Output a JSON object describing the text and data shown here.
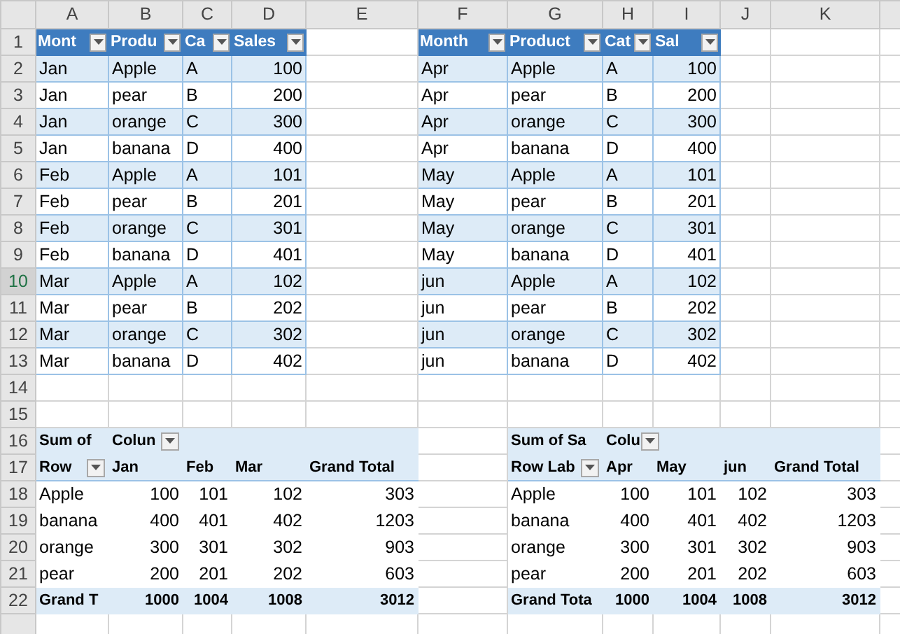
{
  "column_headers": [
    "A",
    "B",
    "C",
    "D",
    "E",
    "F",
    "G",
    "H",
    "I",
    "J",
    "K"
  ],
  "row_headers": [
    {
      "label": "1",
      "selected": false
    },
    {
      "label": "2",
      "selected": false
    },
    {
      "label": "3",
      "selected": false
    },
    {
      "label": "4",
      "selected": false
    },
    {
      "label": "5",
      "selected": false
    },
    {
      "label": "6",
      "selected": false
    },
    {
      "label": "7",
      "selected": false
    },
    {
      "label": "8",
      "selected": false
    },
    {
      "label": "9",
      "selected": false
    },
    {
      "label": "10",
      "selected": true
    },
    {
      "label": "11",
      "selected": false
    },
    {
      "label": "12",
      "selected": false
    },
    {
      "label": "13",
      "selected": false
    },
    {
      "label": "14",
      "selected": false
    },
    {
      "label": "15",
      "selected": false
    },
    {
      "label": "16",
      "selected": false
    },
    {
      "label": "17",
      "selected": false
    },
    {
      "label": "18",
      "selected": false
    },
    {
      "label": "19",
      "selected": false
    },
    {
      "label": "20",
      "selected": false
    },
    {
      "label": "21",
      "selected": false
    },
    {
      "label": "22",
      "selected": false
    }
  ],
  "tables": [
    {
      "columns": [
        "Mont",
        "Produ",
        "Ca",
        "Sales"
      ],
      "rows": [
        [
          "Jan",
          "Apple",
          "A",
          "100"
        ],
        [
          "Jan",
          "pear",
          "B",
          "200"
        ],
        [
          "Jan",
          "orange",
          "C",
          "300"
        ],
        [
          "Jan",
          "banana",
          "D",
          "400"
        ],
        [
          "Feb",
          "Apple",
          "A",
          "101"
        ],
        [
          "Feb",
          "pear",
          "B",
          "201"
        ],
        [
          "Feb",
          "orange",
          "C",
          "301"
        ],
        [
          "Feb",
          "banana",
          "D",
          "401"
        ],
        [
          "Mar",
          "Apple",
          "A",
          "102"
        ],
        [
          "Mar",
          "pear",
          "B",
          "202"
        ],
        [
          "Mar",
          "orange",
          "C",
          "302"
        ],
        [
          "Mar",
          "banana",
          "D",
          "402"
        ]
      ]
    },
    {
      "columns": [
        "Month",
        "Product",
        "Cat",
        "Sal"
      ],
      "rows": [
        [
          "Apr",
          "Apple",
          "A",
          "100"
        ],
        [
          "Apr",
          "pear",
          "B",
          "200"
        ],
        [
          "Apr",
          "orange",
          "C",
          "300"
        ],
        [
          "Apr",
          "banana",
          "D",
          "400"
        ],
        [
          "May",
          "Apple",
          "A",
          "101"
        ],
        [
          "May",
          "pear",
          "B",
          "201"
        ],
        [
          "May",
          "orange",
          "C",
          "301"
        ],
        [
          "May",
          "banana",
          "D",
          "401"
        ],
        [
          "jun",
          "Apple",
          "A",
          "102"
        ],
        [
          "jun",
          "pear",
          "B",
          "202"
        ],
        [
          "jun",
          "orange",
          "C",
          "302"
        ],
        [
          "jun",
          "banana",
          "D",
          "402"
        ]
      ]
    }
  ],
  "pivots": [
    {
      "title": [
        {
          "text": "Sum of",
          "filter": false
        },
        {
          "text": "Colun",
          "filter": true
        }
      ],
      "header": [
        {
          "text": "Row",
          "filter": true
        },
        {
          "text": "Jan",
          "filter": false
        },
        {
          "text": "Feb",
          "filter": false
        },
        {
          "text": "Mar",
          "filter": false
        },
        {
          "text": "Grand Total",
          "filter": false
        }
      ],
      "rows": [
        [
          "Apple",
          "100",
          "101",
          "102",
          "303"
        ],
        [
          "banana",
          "400",
          "401",
          "402",
          "1203"
        ],
        [
          "orange",
          "300",
          "301",
          "302",
          "903"
        ],
        [
          "pear",
          "200",
          "201",
          "202",
          "603"
        ]
      ],
      "total": [
        "Grand T",
        "1000",
        "1004",
        "1008",
        "3012"
      ]
    },
    {
      "title": [
        {
          "text": "Sum of Sa",
          "filter": false
        },
        {
          "text": "Colu",
          "filter": true
        }
      ],
      "header": [
        {
          "text": "Row Lab",
          "filter": true
        },
        {
          "text": "Apr",
          "filter": false
        },
        {
          "text": "May",
          "filter": false
        },
        {
          "text": "jun",
          "filter": false
        },
        {
          "text": "Grand Total",
          "filter": false
        }
      ],
      "rows": [
        [
          "Apple",
          "100",
          "101",
          "102",
          "303"
        ],
        [
          "banana",
          "400",
          "401",
          "402",
          "1203"
        ],
        [
          "orange",
          "300",
          "301",
          "302",
          "903"
        ],
        [
          "pear",
          "200",
          "201",
          "202",
          "603"
        ]
      ],
      "total": [
        "Grand Tota",
        "1000",
        "1004",
        "1008",
        "3012"
      ]
    }
  ]
}
